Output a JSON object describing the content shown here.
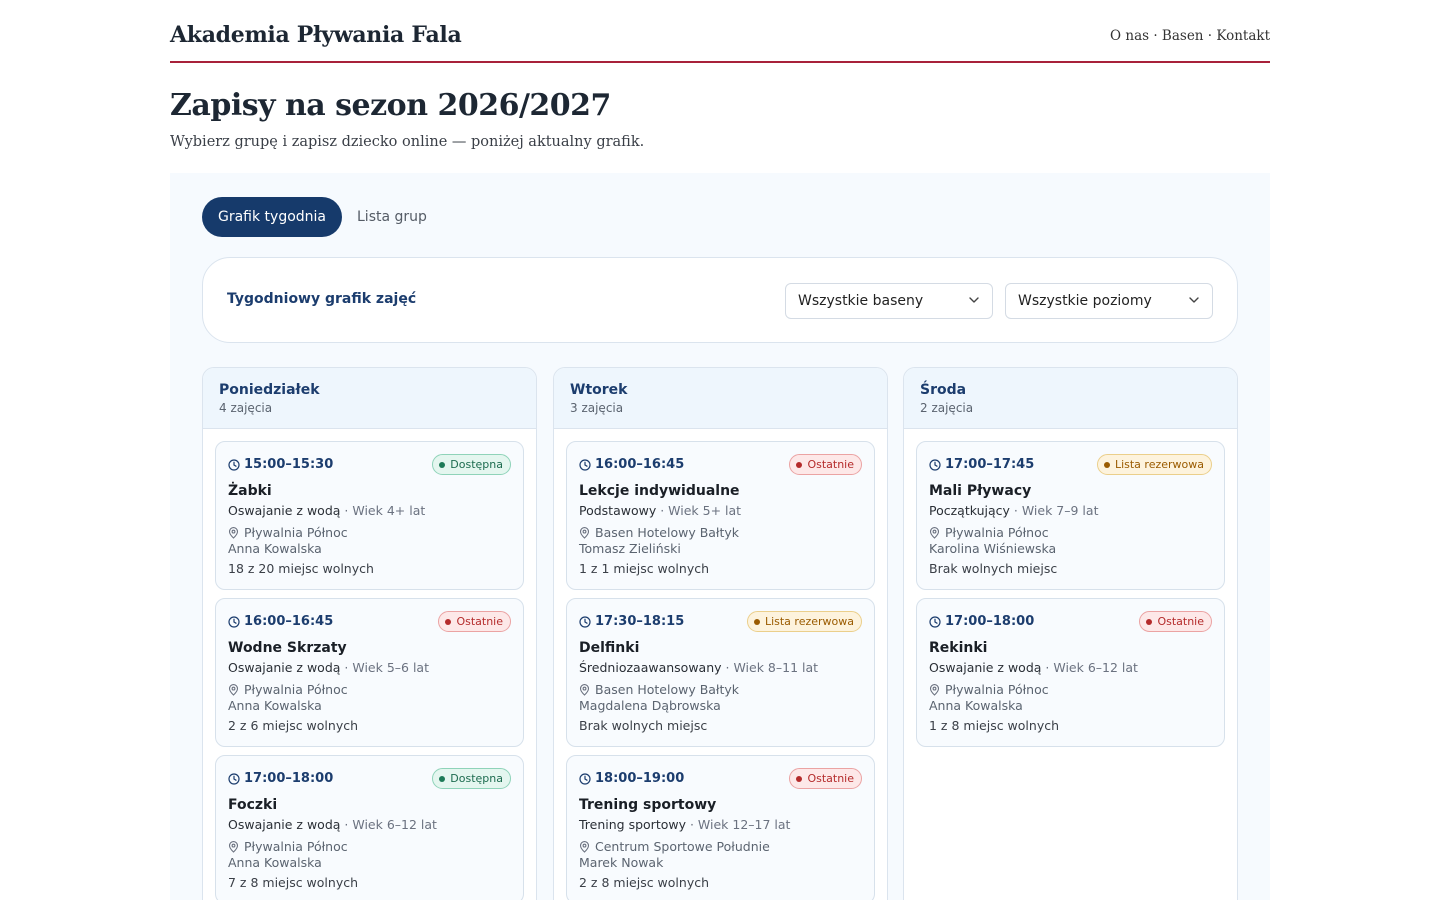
{
  "header": {
    "brand": "Akademia Pływania Fala",
    "nav": "O nas · Basen · Kontakt"
  },
  "page": {
    "title": "Zapisy na sezon 2026/2027",
    "subtitle": "Wybierz grupę i zapisz dziecko online — poniżej aktualny grafik."
  },
  "tabs": [
    {
      "label": "Grafik tygodnia",
      "active": true
    },
    {
      "label": "Lista grup",
      "active": false
    }
  ],
  "filters": {
    "title": "Tygodniowy grafik zajęć",
    "pool_select": "Wszystkie baseny",
    "level_select": "Wszystkie poziomy"
  },
  "colors": {
    "primary": "#163a6b",
    "accent_rule": "#a8213a",
    "available": "#1d7a57",
    "last": "#b42b2b",
    "waitlist": "#9a5b00"
  },
  "days": [
    {
      "name": "Poniedziałek",
      "count": "4 zajęcia",
      "classes": [
        {
          "time": "15:00–15:30",
          "status": "Dostępna",
          "status_kind": "green",
          "name": "Żabki",
          "level": "Oswajanie z wodą",
          "age": " · Wiek 4+ lat",
          "pool": "Pływalnia Północ",
          "coach": "Anna Kowalska",
          "seats": "18 z 20 miejsc wolnych"
        },
        {
          "time": "16:00–16:45",
          "status": "Ostatnie",
          "status_kind": "red",
          "name": "Wodne Skrzaty",
          "level": "Oswajanie z wodą",
          "age": " · Wiek 5–6 lat",
          "pool": "Pływalnia Północ",
          "coach": "Anna Kowalska",
          "seats": "2 z 6 miejsc wolnych"
        },
        {
          "time": "17:00–18:00",
          "status": "Dostępna",
          "status_kind": "green",
          "name": "Foczki",
          "level": "Oswajanie z wodą",
          "age": " · Wiek 6–12 lat",
          "pool": "Pływalnia Północ",
          "coach": "Anna Kowalska",
          "seats": "7 z 8 miejsc wolnych"
        }
      ]
    },
    {
      "name": "Wtorek",
      "count": "3 zajęcia",
      "classes": [
        {
          "time": "16:00–16:45",
          "status": "Ostatnie",
          "status_kind": "red",
          "name": "Lekcje indywidualne",
          "level": "Podstawowy",
          "age": " · Wiek 5+ lat",
          "pool": "Basen Hotelowy Bałtyk",
          "coach": "Tomasz Zieliński",
          "seats": "1 z 1 miejsc wolnych"
        },
        {
          "time": "17:30–18:15",
          "status": "Lista rezerwowa",
          "status_kind": "amber",
          "name": "Delfinki",
          "level": "Średniozaawansowany",
          "age": " · Wiek 8–11 lat",
          "pool": "Basen Hotelowy Bałtyk",
          "coach": "Magdalena Dąbrowska",
          "seats": "Brak wolnych miejsc"
        },
        {
          "time": "18:00–19:00",
          "status": "Ostatnie",
          "status_kind": "red",
          "name": "Trening sportowy",
          "level": "Trening sportowy",
          "age": " · Wiek 12–17 lat",
          "pool": "Centrum Sportowe Południe",
          "coach": "Marek Nowak",
          "seats": "2 z 8 miejsc wolnych"
        }
      ]
    },
    {
      "name": "Środa",
      "count": "2 zajęcia",
      "classes": [
        {
          "time": "17:00–17:45",
          "status": "Lista rezerwowa",
          "status_kind": "amber",
          "name": "Mali Pływacy",
          "level": "Początkujący",
          "age": " · Wiek 7–9 lat",
          "pool": "Pływalnia Północ",
          "coach": "Karolina Wiśniewska",
          "seats": "Brak wolnych miejsc"
        },
        {
          "time": "17:00–18:00",
          "status": "Ostatnie",
          "status_kind": "red",
          "name": "Rekinki",
          "level": "Oswajanie z wodą",
          "age": " · Wiek 6–12 lat",
          "pool": "Pływalnia Północ",
          "coach": "Anna Kowalska",
          "seats": "1 z 8 miejsc wolnych"
        }
      ]
    }
  ]
}
